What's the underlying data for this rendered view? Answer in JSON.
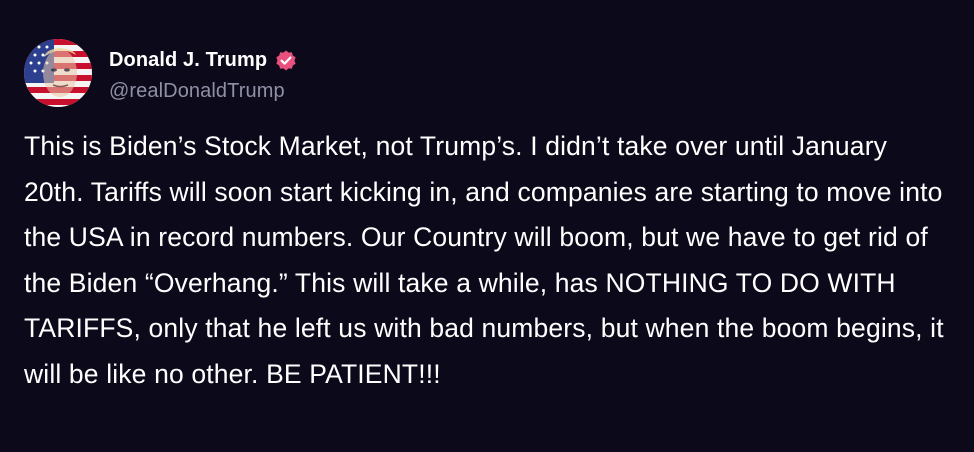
{
  "post": {
    "author": {
      "display_name": "Donald J. Trump",
      "handle": "@realDonaldTrump",
      "verified": true,
      "verified_icon": "verified-badge-icon",
      "verified_color": "#e8507e"
    },
    "text": "This is Biden’s Stock Market, not Trump’s. I didn’t take over until January 20th. Tariffs will soon start kicking in, and companies are starting to move into the USA in record numbers. Our Country will boom, but we have to get rid of the Biden “Overhang.” This will take a while, has NOTHING TO DO WITH TARIFFS, only that he left us with bad numbers, but when the boom begins, it will be like no other. BE PATIENT!!!"
  },
  "colors": {
    "background": "#0c0a1a",
    "text": "#ffffff",
    "handle": "#8f8fa6"
  }
}
